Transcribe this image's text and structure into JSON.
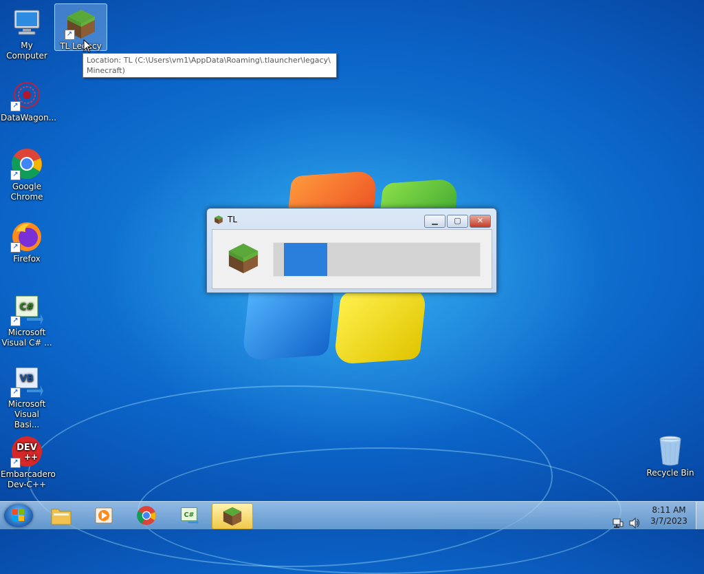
{
  "desktop": {
    "icons": [
      {
        "label": "My Computer",
        "icon": "computer-icon"
      },
      {
        "label": "TL Legacy",
        "icon": "minecraft-grass-block-icon"
      },
      {
        "label": "DataWagon...",
        "icon": "datawagon-icon"
      },
      {
        "label": "Google Chrome",
        "icon": "chrome-icon"
      },
      {
        "label": "Firefox",
        "icon": "firefox-icon"
      },
      {
        "label": "Microsoft Visual C# ...",
        "icon": "visual-csharp-icon"
      },
      {
        "label": "Microsoft Visual Basi...",
        "icon": "visual-basic-icon"
      },
      {
        "label": "Embarcadero Dev-C++",
        "icon": "devcpp-icon"
      },
      {
        "label": "Recycle Bin",
        "icon": "recycle-bin-icon"
      }
    ],
    "tooltip": "Location: TL (C:\\Users\\vm1\\AppData\\Roaming\\.tlauncher\\legacy\\ Minecraft)"
  },
  "icon_text": {
    "csharp": "C#",
    "vb": "VB",
    "dev": "DEV",
    "dev_plus": "++",
    "shortcut": "↗"
  },
  "window": {
    "title": "TL",
    "minimize": "▁",
    "maximize": "▢",
    "close": "✕",
    "progress": 0.21
  },
  "taskbar": {
    "items": [
      "windows-explorer-icon",
      "media-player-icon",
      "chrome-icon",
      "visual-csharp-icon",
      "minecraft-grass-block-icon"
    ],
    "active_item": 4,
    "clock_time": "8:11 AM",
    "clock_date": "3/7/2023"
  },
  "colors": {
    "progress_fill": "#2b7fdc",
    "grass_top": "#5aa83a",
    "dirt": "#7a5230"
  }
}
